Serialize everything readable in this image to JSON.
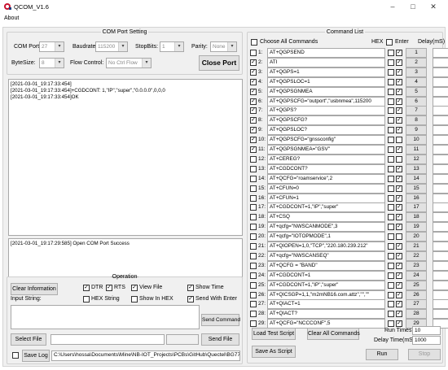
{
  "window": {
    "title": "QCOM_V1.6",
    "minimize": "–",
    "maximize": "□",
    "close": "✕"
  },
  "menu": {
    "about": "About"
  },
  "com_setting": {
    "legend": "COM Port Setting",
    "com_port_label": "COM Port:",
    "com_port_value": "27",
    "baudrate_label": "Baudrate:",
    "baudrate_value": "115200",
    "stopbits_label": "StopBits:",
    "stopbits_value": "1",
    "parity_label": "Parity:",
    "parity_value": "None",
    "bytesize_label": "ByteSize:",
    "bytesize_value": "8",
    "flow_label": "Flow Control:",
    "flow_value": "No Ctrl Flow",
    "close_port": "Close Port"
  },
  "log": [
    "[2021-03-01_19:17:33:454]",
    "[2021-03-01_19:17:33:454]+CGDCONT: 1,\"IP\",\"super\",\"0.0.0.0\",0,0,0",
    "",
    "[2021-03-01_19:17:33:454]OK"
  ],
  "status_log": "[2021-03-01_19:17:29:585] Open COM Port Success",
  "operation": {
    "legend": "Operation",
    "clear_info": "Clear Information",
    "dtr": "DTR",
    "rts": "RTS",
    "view_file": "View File",
    "show_time": "Show Time",
    "hex_string": "HEX String",
    "show_in_hex": "Show In HEX",
    "send_with_enter": "Send With Enter",
    "input_label": "Input String:",
    "send_command": "Send Command",
    "select_file": "Select File",
    "send_file": "Send File",
    "save_log": "Save Log",
    "log_path": "C:\\Users\\hossa\\Documents\\Mine\\NB-IOT_Projects\\PCBs\\GitHub\\Quectel\\BG77\\QCC"
  },
  "command_list": {
    "legend": "Command List",
    "choose_all": "Choose All Commands",
    "hex_header": "HEX",
    "enter_header": "Enter",
    "delay_header": "Delay(mS)",
    "commands": [
      {
        "n": "1:",
        "cmd": "AT+QGPSEND",
        "checked": false,
        "enter": true
      },
      {
        "n": "2:",
        "cmd": "ATI",
        "checked": true,
        "enter": true
      },
      {
        "n": "3:",
        "cmd": "AT+QGPS=1",
        "checked": true,
        "enter": true
      },
      {
        "n": "4:",
        "cmd": "AT+QGPSLOC=1",
        "checked": true,
        "enter": true
      },
      {
        "n": "5:",
        "cmd": "AT+QGPSGNMEA",
        "checked": true,
        "enter": true
      },
      {
        "n": "6:",
        "cmd": "AT+QGPSCFG=\"outport\",\"usbnmea\",115200",
        "checked": true,
        "enter": true
      },
      {
        "n": "7:",
        "cmd": "AT+QGPS?",
        "checked": true,
        "enter": true
      },
      {
        "n": "8:",
        "cmd": "AT+QGPSCFG?",
        "checked": true,
        "enter": true
      },
      {
        "n": "9:",
        "cmd": "AT+QGPSLOC?",
        "checked": true,
        "enter": true
      },
      {
        "n": "10:",
        "cmd": "AT+QGPSCFG=\"gnssconfig\"",
        "checked": true,
        "enter": false
      },
      {
        "n": "11:",
        "cmd": "AT+QGPSGNMEA=\"GSV\"",
        "checked": true,
        "enter": true
      },
      {
        "n": "12:",
        "cmd": "AT+CEREG?",
        "checked": false,
        "enter": false
      },
      {
        "n": "13:",
        "cmd": "AT+CGDCONT?",
        "checked": false,
        "enter": true
      },
      {
        "n": "14:",
        "cmd": "AT+QCFG=\"roamservice\",2",
        "checked": false,
        "enter": true
      },
      {
        "n": "15:",
        "cmd": "AT+CFUN=0",
        "checked": false,
        "enter": true
      },
      {
        "n": "16:",
        "cmd": "AT+CFUN=1",
        "checked": false,
        "enter": true
      },
      {
        "n": "17:",
        "cmd": "AT+CGDCONT=1,\"IP\",\"super\"",
        "checked": false,
        "enter": true
      },
      {
        "n": "18:",
        "cmd": "AT+CSQ",
        "checked": false,
        "enter": true
      },
      {
        "n": "19:",
        "cmd": "AT+qcfg=\"NWSCANMODE\",3",
        "checked": false,
        "enter": true
      },
      {
        "n": "20:",
        "cmd": "AT+qcfg=\"IOTOPMODE\",1",
        "checked": false,
        "enter": false
      },
      {
        "n": "21:",
        "cmd": "AT+QIOPEN=1,0,\"TCP\",\"220.180.239.212\"",
        "checked": false,
        "enter": true
      },
      {
        "n": "22:",
        "cmd": "AT+qcfg=\"NWSCANSEQ\"",
        "checked": false,
        "enter": true
      },
      {
        "n": "23:",
        "cmd": "AT+QCFG = \"BAND\"",
        "checked": false,
        "enter": true
      },
      {
        "n": "24:",
        "cmd": "AT+CGDCONT=1",
        "checked": false,
        "enter": true
      },
      {
        "n": "25:",
        "cmd": "AT+CGDCONT=1,\"IP\",\"super\"",
        "checked": false,
        "enter": true
      },
      {
        "n": "26:",
        "cmd": "AT+QICSGP=1,1,\"m2mNB16.com.attz\",\"\",\"\"",
        "checked": false,
        "enter": true
      },
      {
        "n": "27:",
        "cmd": "AT+QIACT=1",
        "checked": false,
        "enter": true
      },
      {
        "n": "28:",
        "cmd": "AT+QIACT?",
        "checked": false,
        "enter": true
      },
      {
        "n": "29:",
        "cmd": "AT+QCFG=\"NCCCONF\",5",
        "checked": false,
        "enter": true
      }
    ],
    "buttons": [
      "1",
      "2",
      "3",
      "4",
      "5",
      "6",
      "7",
      "8",
      "9",
      "10",
      "11",
      "12",
      "13",
      "14",
      "15",
      "16",
      "17",
      "18",
      "19",
      "20",
      "21",
      "22",
      "23",
      "24",
      "25",
      "26",
      "27",
      "28",
      "29"
    ],
    "load_script": "Load Test Script",
    "clear_all": "Clear All Commands",
    "save_script": "Save As Script",
    "run_times_label": "Run Times:",
    "run_times_value": "10",
    "delay_time_label": "Delay Time(mS):",
    "delay_time_value": "1000",
    "run": "Run",
    "stop": "Stop"
  },
  "colors": {
    "window_bg": "#f0f0f0",
    "button_bg": "#e1e1e1",
    "icon_red": "#c8102e"
  }
}
